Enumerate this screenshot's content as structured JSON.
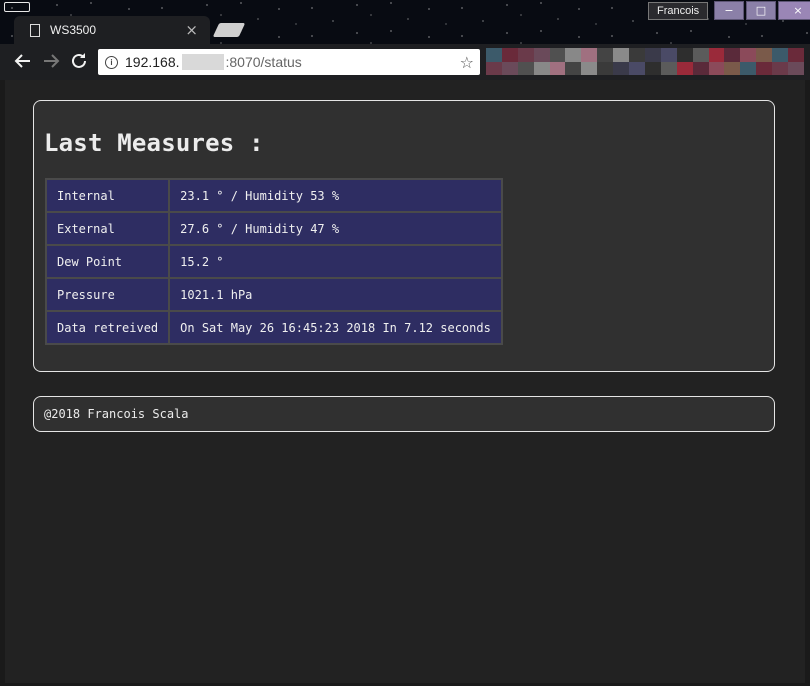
{
  "browser": {
    "tab_title": "WS3500",
    "tab_close": "×",
    "profile_name": "Francois",
    "window_controls": [
      "−",
      "□",
      "×"
    ],
    "url_host": "192.168.",
    "url_path": ":8070/status",
    "icons": {
      "back": "arrow-left-icon",
      "forward": "arrow-right-icon",
      "reload": "reload-icon",
      "info": "info-icon",
      "star": "star-icon"
    }
  },
  "page": {
    "title": "Last Measures :",
    "measures": [
      {
        "label": "Internal",
        "value": "23.1 ° / Humidity 53 %"
      },
      {
        "label": "External",
        "value": "27.6 ° / Humidity 47 %"
      },
      {
        "label": "Dew Point",
        "value": "15.2 °"
      },
      {
        "label": "Pressure",
        "value": "1021.1 hPa"
      },
      {
        "label": "Data retreived",
        "value": "On Sat May 26 16:45:23 2018 In 7.12 seconds"
      }
    ],
    "footer": "@2018 Francois Scala"
  },
  "colors": {
    "page_bg": "#222222",
    "card_bg": "#303030",
    "table_bg": "#2e2d62",
    "border": "#e5e5e5"
  }
}
